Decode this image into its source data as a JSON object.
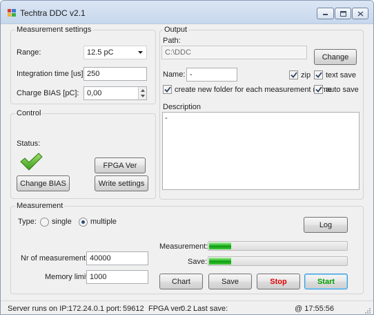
{
  "window": {
    "title": "Techtra DDC v2.1"
  },
  "measurement_settings": {
    "group_label": "Measurement settings",
    "range_label": "Range:",
    "range_value": "12.5 pC",
    "integration_label": "Integration time [us]:",
    "integration_value": "250",
    "charge_bias_label": "Charge BIAS [pC]:",
    "charge_bias_value": "0,00"
  },
  "control": {
    "group_label": "Control",
    "status_label": "Status:",
    "fpga_ver_button": "FPGA Ver",
    "change_bias_button": "Change BIAS",
    "write_settings_button": "Write settings"
  },
  "output": {
    "group_label": "Output",
    "path_label": "Path:",
    "path_value": "C:\\DDC",
    "change_button": "Change",
    "name_label": "Name:",
    "name_value": "-",
    "zip_label": "zip",
    "zip_checked": true,
    "text_save_label": "text save",
    "text_save_checked": true,
    "new_folder_label": "create new folder for each measurement name",
    "new_folder_checked": true,
    "auto_save_label": "auto save",
    "auto_save_checked": true,
    "description_label": "Description",
    "description_value": "-"
  },
  "measurement": {
    "group_label": "Measurement",
    "type_label": "Type:",
    "type_single": "single",
    "type_multiple": "multiple",
    "type_selected": "multiple",
    "log_button": "Log",
    "nr_label": "Nr of measurement:",
    "nr_value": "40000",
    "memory_label": "Memory limit:",
    "memory_value": "1000",
    "measurement_progress_label": "Measurement:",
    "measurement_progress_fraction": 0.16,
    "save_progress_label": "Save:",
    "save_progress_fraction": 0.16,
    "chart_button": "Chart",
    "save_button": "Save",
    "stop_button": "Stop",
    "start_button": "Start",
    "stop_color": "#e00000",
    "start_color": "#00a000"
  },
  "statusbar": {
    "server_label": "Server runs on IP:",
    "server_ip": "172.24.0.1",
    "port_label": "port:",
    "port_value": "59612",
    "fpga_label": "FPGA ver:",
    "fpga_value": "0.2",
    "last_save_label": "Last save:",
    "time": "@ 17:55:56"
  }
}
